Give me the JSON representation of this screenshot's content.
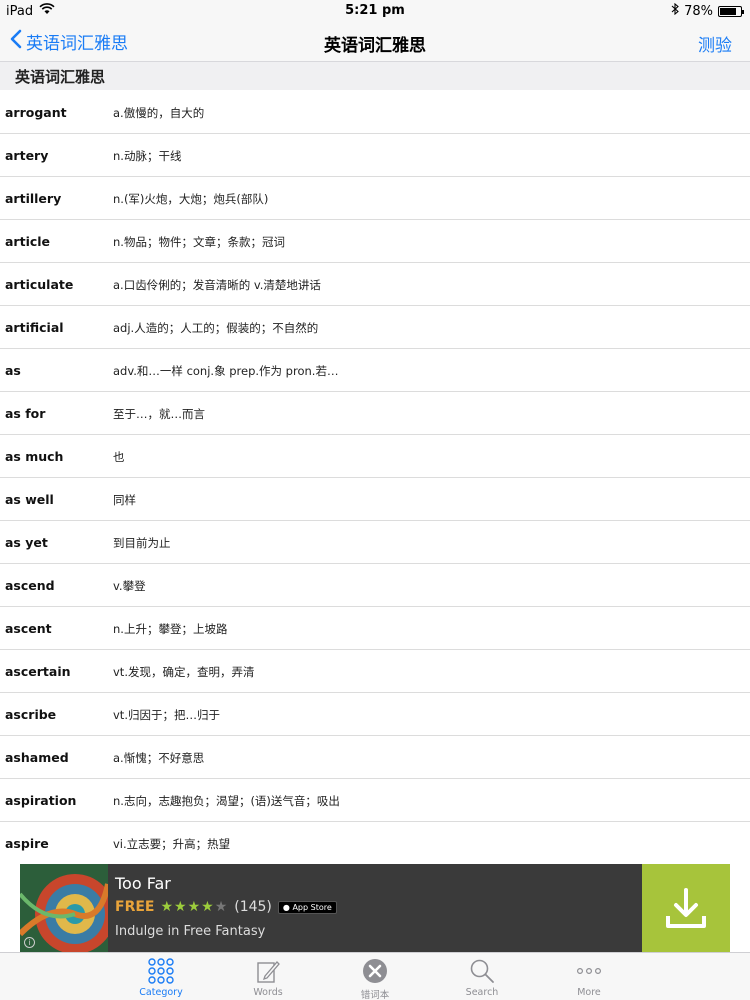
{
  "status_bar": {
    "device": "iPad",
    "time": "5:21 pm",
    "battery": "78%",
    "battery_level": 0.78,
    "icons": [
      "wifi-icon",
      "bluetooth-icon",
      "battery-icon"
    ]
  },
  "nav": {
    "back_label": "英语词汇雅思",
    "title": "英语词汇雅思",
    "right_label": "测验"
  },
  "section": {
    "title": "英语词汇雅思"
  },
  "words": [
    {
      "word": "arrogant",
      "meaning": "a.傲慢的，自大的"
    },
    {
      "word": "artery",
      "meaning": "n.动脉；干线"
    },
    {
      "word": "artillery",
      "meaning": "n.(军)火炮，大炮；炮兵(部队)"
    },
    {
      "word": "article",
      "meaning": "n.物品；物件；文章；条款；冠词"
    },
    {
      "word": "articulate",
      "meaning": "a.口齿伶俐的；发音清晰的 v.清楚地讲话"
    },
    {
      "word": "artificial",
      "meaning": "adj.人造的；人工的；假装的；不自然的"
    },
    {
      "word": "as",
      "meaning": "adv.和…一样 conj.象 prep.作为 pron.若…"
    },
    {
      "word": "as for",
      "meaning": "至于…，就…而言"
    },
    {
      "word": "as much",
      "meaning": "也"
    },
    {
      "word": "as well",
      "meaning": "同样"
    },
    {
      "word": "as yet",
      "meaning": "到目前为止"
    },
    {
      "word": "ascend",
      "meaning": "v.攀登"
    },
    {
      "word": "ascent",
      "meaning": "n.上升；攀登；上坡路"
    },
    {
      "word": "ascertain",
      "meaning": "vt.发现，确定，查明，弄清"
    },
    {
      "word": "ascribe",
      "meaning": "vt.归因于；把…归于"
    },
    {
      "word": "ashamed",
      "meaning": "a.惭愧；不好意思"
    },
    {
      "word": "aspiration",
      "meaning": "n.志向，志趣抱负；渴望；(语)送气音；吸出"
    },
    {
      "word": "aspire",
      "meaning": "vi.立志要；升高；热望"
    }
  ],
  "ad": {
    "title": "Too Far",
    "price": "FREE",
    "rating": 4,
    "stars_filled": "★★★★",
    "stars_empty": "★",
    "review_count": "(145)",
    "store_badge": "App Store",
    "subtitle": "Indulge in Free Fantasy",
    "accent_color": "#a7c43b"
  },
  "tabs": [
    {
      "label": "Category",
      "icon": "grid-icon",
      "active": true
    },
    {
      "label": "Words",
      "icon": "edit-icon",
      "active": false
    },
    {
      "label": "错词本",
      "icon": "x-circle-icon",
      "active": false
    },
    {
      "label": "Search",
      "icon": "search-icon",
      "active": false
    },
    {
      "label": "More",
      "icon": "more-icon",
      "active": false
    }
  ],
  "colors": {
    "accent": "#1a7cf5",
    "inactive_tab": "#8e8e93"
  }
}
